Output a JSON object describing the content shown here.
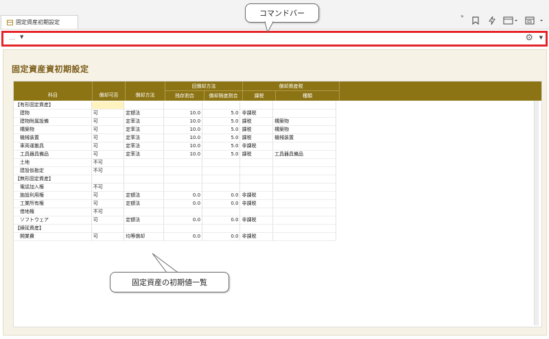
{
  "tab": {
    "title": "固定資産初期設定"
  },
  "toolbar_icons": [
    "chevrons-right-icon",
    "bookmark-icon",
    "lightning-icon",
    "window-icon",
    "calendar-icon"
  ],
  "command_bar": {
    "more_label": "…"
  },
  "page": {
    "title": "固定資産資初期設定"
  },
  "table": {
    "group_headers": {
      "old_depreciation": "旧償却方法",
      "depreciable_asset_tax": "償却資産税"
    },
    "columns": [
      "科目",
      "償却可否",
      "償却方法",
      "残存割合",
      "償却限度割合",
      "課税",
      "種類"
    ],
    "rows": [
      {
        "subject": "【有形固定資産】",
        "can": "",
        "method": "",
        "residual": "",
        "limit": "",
        "tax": "",
        "kind": ""
      },
      {
        "subject": "　建物",
        "can": "可",
        "method": "定額法",
        "residual": "10.0",
        "limit": "5.0",
        "tax": "非課税",
        "kind": ""
      },
      {
        "subject": "　建物附属設備",
        "can": "可",
        "method": "定率法",
        "residual": "10.0",
        "limit": "5.0",
        "tax": "課税",
        "kind": "構築物"
      },
      {
        "subject": "　構築物",
        "can": "可",
        "method": "定率法",
        "residual": "10.0",
        "limit": "5.0",
        "tax": "課税",
        "kind": "構築物"
      },
      {
        "subject": "　機械装置",
        "can": "可",
        "method": "定率法",
        "residual": "10.0",
        "limit": "5.0",
        "tax": "課税",
        "kind": "機械装置"
      },
      {
        "subject": "　車両運搬具",
        "can": "可",
        "method": "定率法",
        "residual": "10.0",
        "limit": "5.0",
        "tax": "非課税",
        "kind": ""
      },
      {
        "subject": "　工具器具備品",
        "can": "可",
        "method": "定率法",
        "residual": "10.0",
        "limit": "5.0",
        "tax": "課税",
        "kind": "工具器具備品"
      },
      {
        "subject": "　土地",
        "can": "不可",
        "method": "",
        "residual": "",
        "limit": "",
        "tax": "",
        "kind": ""
      },
      {
        "subject": "　建設仮勘定",
        "can": "不可",
        "method": "",
        "residual": "",
        "limit": "",
        "tax": "",
        "kind": ""
      },
      {
        "subject": "【無形固定資産】",
        "can": "",
        "method": "",
        "residual": "",
        "limit": "",
        "tax": "",
        "kind": ""
      },
      {
        "subject": "　電話加入権",
        "can": "不可",
        "method": "",
        "residual": "",
        "limit": "",
        "tax": "",
        "kind": ""
      },
      {
        "subject": "　施設利用権",
        "can": "可",
        "method": "定額法",
        "residual": "0.0",
        "limit": "0.0",
        "tax": "非課税",
        "kind": ""
      },
      {
        "subject": "　工業所有権",
        "can": "可",
        "method": "定額法",
        "residual": "0.0",
        "limit": "0.0",
        "tax": "非課税",
        "kind": ""
      },
      {
        "subject": "　借地権",
        "can": "不可",
        "method": "",
        "residual": "",
        "limit": "",
        "tax": "",
        "kind": ""
      },
      {
        "subject": "　ソフトウェア",
        "can": "可",
        "method": "定額法",
        "residual": "0.0",
        "limit": "0.0",
        "tax": "非課税",
        "kind": ""
      },
      {
        "subject": "【繰延資産】",
        "can": "",
        "method": "",
        "residual": "",
        "limit": "",
        "tax": "",
        "kind": ""
      },
      {
        "subject": "　開業費",
        "can": "可",
        "method": "均等償却",
        "residual": "0.0",
        "limit": "0.0",
        "tax": "非課税",
        "kind": ""
      }
    ]
  },
  "callouts": {
    "command_bar": "コマンドバー",
    "table": "固定資産の初期値一覧"
  },
  "colors": {
    "header": "#8c7414",
    "highlight": "#e5242a",
    "title": "#7a5c17",
    "selected_cell": "#fff3c0"
  }
}
